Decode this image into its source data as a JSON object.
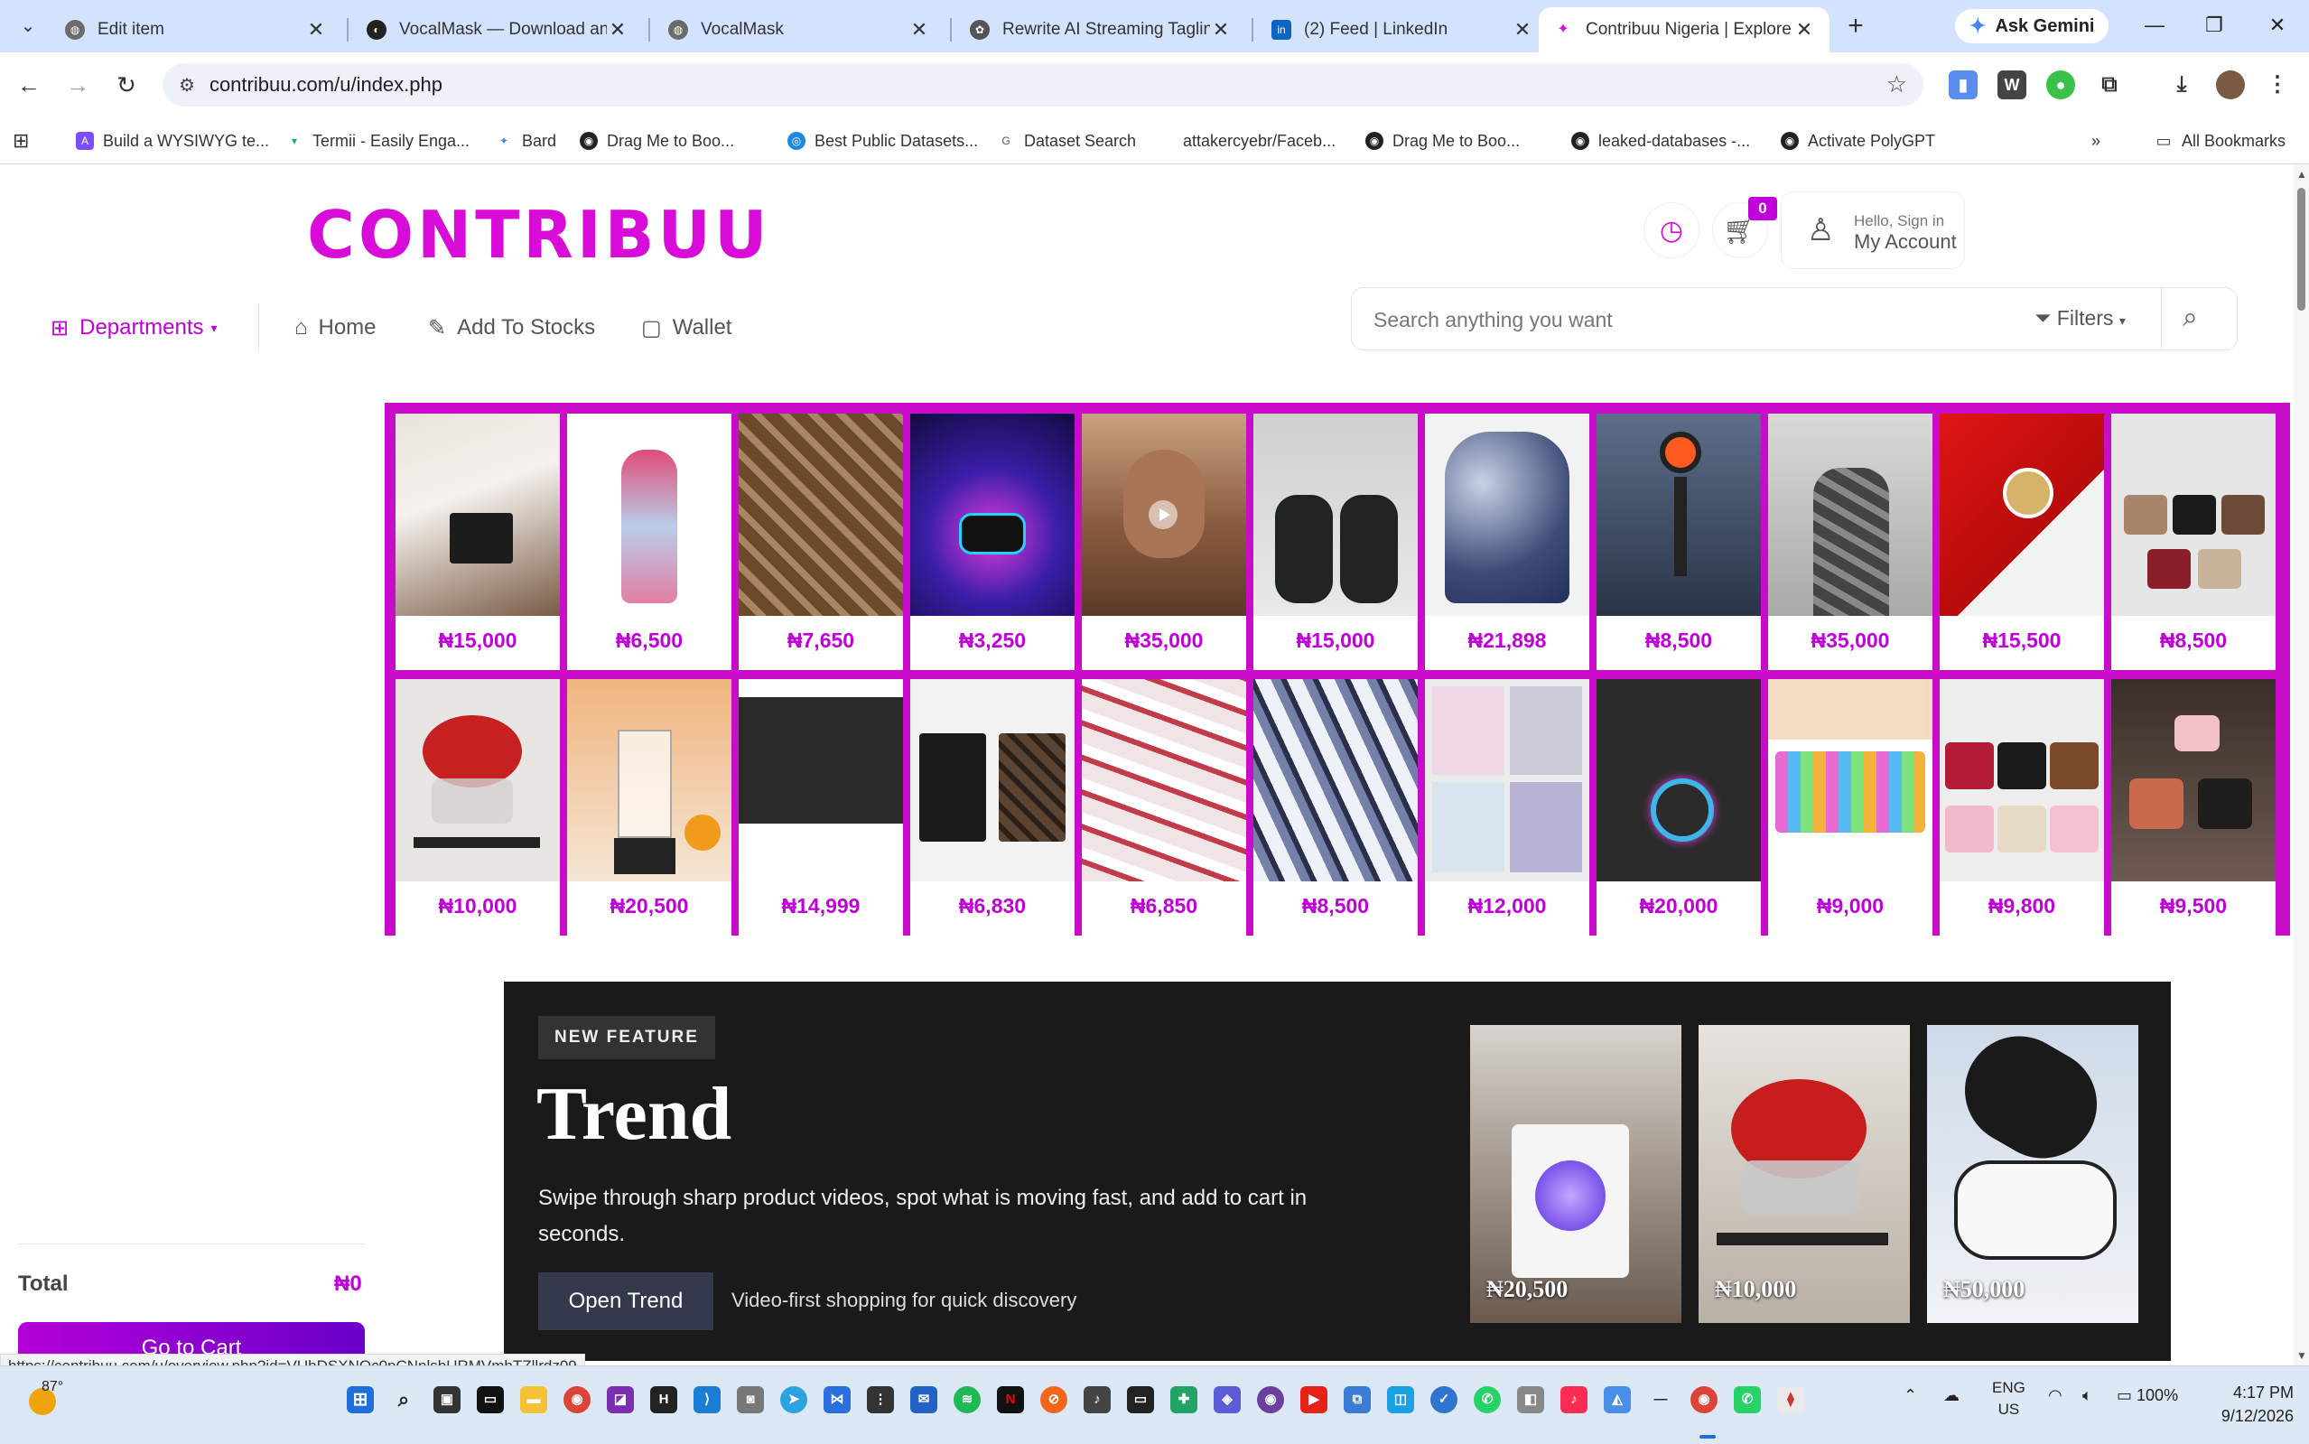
{
  "browser": {
    "tabs": [
      {
        "title": "Edit item",
        "active": false
      },
      {
        "title": "VocalMask — Download an",
        "active": false
      },
      {
        "title": "VocalMask",
        "active": false
      },
      {
        "title": "Rewrite AI Streaming Taglin",
        "active": false
      },
      {
        "title": "(2) Feed | LinkedIn",
        "active": false
      },
      {
        "title": "Contribuu Nigeria | Explore",
        "active": true
      }
    ],
    "ask_gemini": "Ask Gemini",
    "url": "contribuu.com/u/index.php",
    "bookmarks": [
      "Build a WYSIWYG te...",
      "Termii - Easily Enga...",
      "Bard",
      "Drag Me to Boo...",
      "Best Public Datasets...",
      "Dataset Search",
      "attakercyebr/Faceb...",
      "Drag Me to Boo...",
      "leaked-databases -...",
      "Activate PolyGPT"
    ],
    "all_bookmarks": "All Bookmarks",
    "status_url": "https://contribuu.com/u/overview.php?id=VUhDSXNQc0pCNnlsbURMVmhTZllrdz09"
  },
  "header": {
    "logo": "CONTRIBUU",
    "cart_count": "0",
    "account_hello": "Hello, Sign in",
    "account_label": "My Account"
  },
  "nav": {
    "departments": "Departments",
    "home": "Home",
    "add_to_stocks": "Add To Stocks",
    "wallet": "Wallet"
  },
  "search": {
    "placeholder": "Search anything you want",
    "filters": "Filters"
  },
  "products": [
    {
      "price": "₦15,000"
    },
    {
      "price": "₦6,500"
    },
    {
      "price": "₦7,650"
    },
    {
      "price": "₦3,250"
    },
    {
      "price": "₦35,000"
    },
    {
      "price": "₦15,000"
    },
    {
      "price": "₦21,898"
    },
    {
      "price": "₦8,500"
    },
    {
      "price": "₦35,000"
    },
    {
      "price": "₦15,500"
    },
    {
      "price": "₦8,500"
    },
    {
      "price": "₦10,000"
    },
    {
      "price": "₦20,500"
    },
    {
      "price": "₦14,999"
    },
    {
      "price": "₦6,830"
    },
    {
      "price": "₦6,850"
    },
    {
      "price": "₦8,500"
    },
    {
      "price": "₦12,000"
    },
    {
      "price": "₦20,000"
    },
    {
      "price": "₦9,000"
    },
    {
      "price": "₦9,800"
    },
    {
      "price": "₦9,500"
    }
  ],
  "cart": {
    "total_label": "Total",
    "total_value": "₦0",
    "go_to_cart": "Go to Cart"
  },
  "trend": {
    "badge": "NEW FEATURE",
    "title": "Trend",
    "description": "Swipe through sharp product videos, spot what is moving fast, and add to cart in seconds.",
    "button": "Open Trend",
    "subtitle": "Video-first shopping for quick discovery",
    "cards": [
      {
        "price": "₦20,500"
      },
      {
        "price": "₦10,000"
      },
      {
        "price": "₦50,000"
      }
    ]
  },
  "taskbar": {
    "temperature": "87°",
    "lang": "ENG",
    "region": "US",
    "battery": "100%",
    "time": "4:17 PM",
    "date": "9/12/2026"
  },
  "colors": {
    "brand": "#d90bd9",
    "grid_border": "#c90cc9",
    "banner_bg": "#1a1a1a"
  }
}
